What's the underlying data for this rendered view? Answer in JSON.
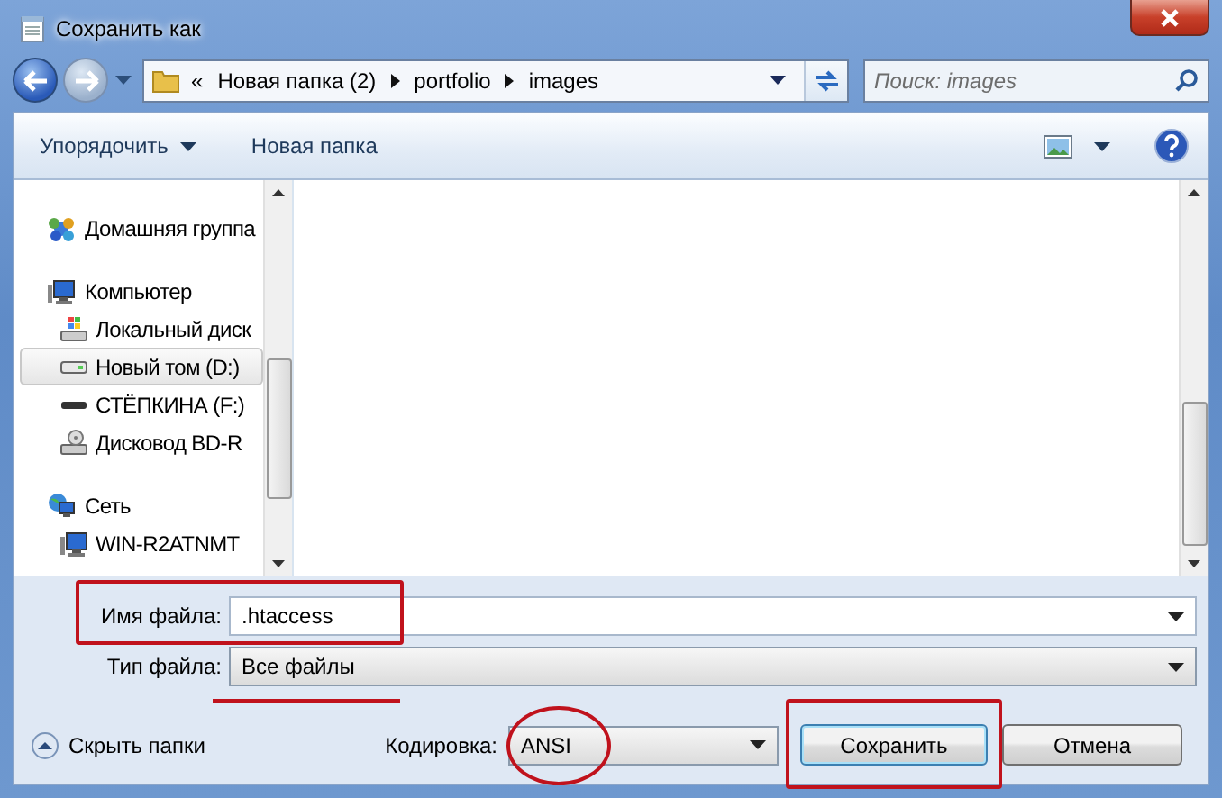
{
  "window": {
    "title": "Сохранить как"
  },
  "address": {
    "overflow_mark": "«",
    "segments": [
      "Новая папка (2)",
      "portfolio",
      "images"
    ]
  },
  "search": {
    "placeholder": "Поиск: images"
  },
  "toolbar": {
    "organize": "Упорядочить",
    "new_folder": "Новая папка"
  },
  "sidebar": {
    "items": [
      {
        "label": "Домашняя группа",
        "kind": "homegroup",
        "selected": false
      },
      {
        "label": "Компьютер",
        "kind": "computer",
        "selected": false,
        "children": [
          {
            "label": "Локальный диск",
            "kind": "system-drive",
            "selected": false
          },
          {
            "label": "Новый том (D:)",
            "kind": "drive",
            "selected": true
          },
          {
            "label": "СТЁПКИНА (F:)",
            "kind": "usb",
            "selected": false
          },
          {
            "label": "Дисковод BD-R",
            "kind": "optical",
            "selected": false
          }
        ]
      },
      {
        "label": "Сеть",
        "kind": "network",
        "selected": false,
        "children": [
          {
            "label": "WIN-R2ATNMT",
            "kind": "computer",
            "selected": false
          }
        ]
      }
    ]
  },
  "file_name": {
    "label": "Имя файла:",
    "value": ".htaccess",
    "boxed": true
  },
  "file_type": {
    "label": "Тип файла:",
    "value": "Все файлы",
    "underlined": true
  },
  "hide_folders": "Скрыть папки",
  "encoding": {
    "label": "Кодировка:",
    "value": "ANSI",
    "circled": true
  },
  "buttons": [
    {
      "label": "Сохранить",
      "default": true,
      "boxed": true
    },
    {
      "label": "Отмена",
      "default": false
    }
  ]
}
